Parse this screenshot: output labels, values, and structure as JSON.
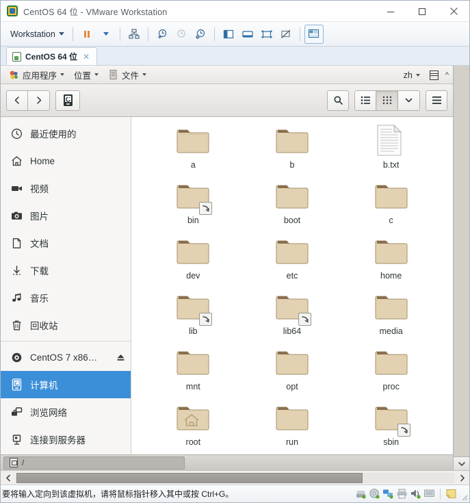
{
  "window": {
    "title": "CentOS 64 位 - VMware Workstation",
    "app_icon": "vmware-icon",
    "minimize_label": "—",
    "maximize_label": "□",
    "close_label": "×"
  },
  "vm_toolbar": {
    "workstation_menu": "Workstation",
    "buttons": [
      {
        "name": "pause-vm",
        "label": "Pause"
      },
      {
        "name": "power-dropdown",
        "label": "Power options"
      },
      {
        "name": "manage-vm",
        "label": "Manage"
      },
      {
        "name": "take-snapshot",
        "label": "Take snapshot"
      },
      {
        "name": "revert-snapshot",
        "label": "Revert snapshot"
      },
      {
        "name": "snapshot-manager",
        "label": "Snapshot manager"
      },
      {
        "name": "show-library",
        "label": "Show library"
      },
      {
        "name": "show-console",
        "label": "Console view"
      },
      {
        "name": "enter-fullscreen",
        "label": "Full screen"
      },
      {
        "name": "unity-mode",
        "label": "Unity mode"
      },
      {
        "name": "vm-settings",
        "label": "Virtual machine settings"
      }
    ]
  },
  "vm_tab": {
    "label": "CentOS 64 位",
    "close": "✕"
  },
  "gnome_panel": {
    "applications": "应用程序",
    "places": "位置",
    "files": "文件",
    "language": "zh",
    "date_icon": "calendar-icon",
    "overflow": "^"
  },
  "nautilus": {
    "nav": {
      "back": "‹",
      "forward": "›",
      "location": "Computer"
    },
    "actions": {
      "search": "search-icon",
      "list_view": "list-view-icon",
      "grid_view": "grid-view-icon",
      "view_options": "chevron-down-icon",
      "menu": "hamburger-menu-icon"
    },
    "pathbar": {
      "crumb": "/"
    },
    "sidebar": [
      {
        "label": "最近使用的",
        "icon": "clock-icon",
        "selected": false,
        "separator_after": false
      },
      {
        "label": "Home",
        "icon": "home-icon",
        "selected": false,
        "separator_after": false
      },
      {
        "label": "视频",
        "icon": "video-icon",
        "selected": false,
        "separator_after": false
      },
      {
        "label": "图片",
        "icon": "camera-icon",
        "selected": false,
        "separator_after": false
      },
      {
        "label": "文档",
        "icon": "document-icon",
        "selected": false,
        "separator_after": false
      },
      {
        "label": "下载",
        "icon": "download-icon",
        "selected": false,
        "separator_after": false
      },
      {
        "label": "音乐",
        "icon": "music-icon",
        "selected": false,
        "separator_after": false
      },
      {
        "label": "回收站",
        "icon": "trash-icon",
        "selected": false,
        "separator_after": true
      },
      {
        "label": "CentOS 7 x86…",
        "icon": "disc-icon",
        "selected": false,
        "eject": true,
        "separator_after": false
      },
      {
        "label": "计算机",
        "icon": "computer-icon",
        "selected": true,
        "separator_after": false
      },
      {
        "label": "浏览网络",
        "icon": "network-icon",
        "selected": false,
        "separator_after": false
      },
      {
        "label": "连接到服务器",
        "icon": "server-icon",
        "selected": false,
        "separator_after": false
      }
    ],
    "files": [
      {
        "name": "a",
        "type": "folder",
        "emblem": "none"
      },
      {
        "name": "b",
        "type": "folder",
        "emblem": "none"
      },
      {
        "name": "b.txt",
        "type": "document",
        "emblem": "none"
      },
      {
        "name": "bin",
        "type": "folder",
        "emblem": "symlink"
      },
      {
        "name": "boot",
        "type": "folder",
        "emblem": "none"
      },
      {
        "name": "c",
        "type": "folder",
        "emblem": "none"
      },
      {
        "name": "dev",
        "type": "folder",
        "emblem": "none"
      },
      {
        "name": "etc",
        "type": "folder",
        "emblem": "none"
      },
      {
        "name": "home",
        "type": "folder",
        "emblem": "none"
      },
      {
        "name": "lib",
        "type": "folder",
        "emblem": "symlink"
      },
      {
        "name": "lib64",
        "type": "folder",
        "emblem": "symlink"
      },
      {
        "name": "media",
        "type": "folder",
        "emblem": "none"
      },
      {
        "name": "mnt",
        "type": "folder",
        "emblem": "none"
      },
      {
        "name": "opt",
        "type": "folder",
        "emblem": "none"
      },
      {
        "name": "proc",
        "type": "folder",
        "emblem": "none"
      },
      {
        "name": "root",
        "type": "folder-home",
        "emblem": "none"
      },
      {
        "name": "run",
        "type": "folder",
        "emblem": "none"
      },
      {
        "name": "sbin",
        "type": "folder",
        "emblem": "symlink"
      }
    ]
  },
  "status_bar": {
    "message": "要将输入定向到该虚拟机，请将鼠标指针移入其中或按 Ctrl+G。",
    "devices": [
      {
        "name": "hard-disk-status-icon"
      },
      {
        "name": "cd-dvd-status-icon"
      },
      {
        "name": "network-status-icon"
      },
      {
        "name": "printer-status-icon"
      },
      {
        "name": "sound-status-icon"
      },
      {
        "name": "display-status-icon"
      },
      {
        "name": "notes-status-icon"
      }
    ]
  },
  "colors": {
    "selection_blue": "#3b8fd9",
    "folder_body": "#e0cfae",
    "folder_tab": "#8a6f4e",
    "vmware_chrome": "#eef2f6",
    "gnome_panel": "#f0eeeb"
  }
}
